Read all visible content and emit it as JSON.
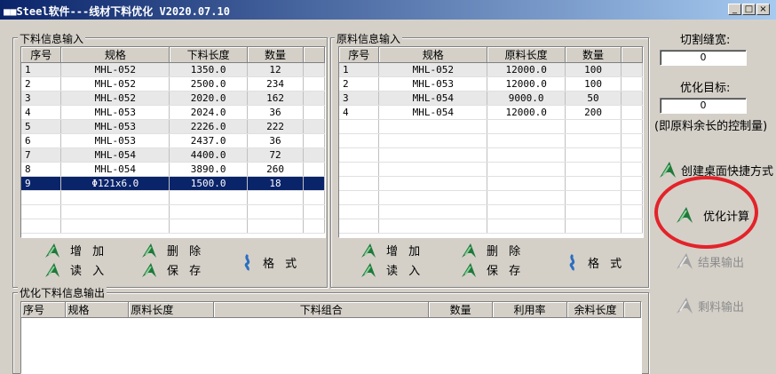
{
  "window": {
    "title": "■■Steel软件---线材下料优化 V2020.07.10",
    "controls": [
      "_",
      "□",
      "×"
    ]
  },
  "cut_group": {
    "title": "下料信息输入",
    "headers": [
      "序号",
      "规格",
      "下料长度",
      "数量"
    ],
    "rows": [
      [
        "1",
        "MHL-052",
        "1350.0",
        "12"
      ],
      [
        "2",
        "MHL-052",
        "2500.0",
        "234"
      ],
      [
        "3",
        "MHL-052",
        "2020.0",
        "162"
      ],
      [
        "4",
        "MHL-053",
        "2024.0",
        "36"
      ],
      [
        "5",
        "MHL-053",
        "2226.0",
        "222"
      ],
      [
        "6",
        "MHL-053",
        "2437.0",
        "36"
      ],
      [
        "7",
        "MHL-054",
        "4400.0",
        "72"
      ],
      [
        "8",
        "MHL-054",
        "3890.0",
        "260"
      ],
      [
        "9",
        "Φ121x6.0",
        "1500.0",
        "18"
      ]
    ],
    "buttons": {
      "add": "增 加",
      "delete": "删 除",
      "read": "读 入",
      "save": "保 存",
      "format": "格 式"
    }
  },
  "raw_group": {
    "title": "原料信息输入",
    "headers": [
      "序号",
      "规格",
      "原料长度",
      "数量"
    ],
    "rows": [
      [
        "1",
        "MHL-052",
        "12000.0",
        "100"
      ],
      [
        "2",
        "MHL-053",
        "12000.0",
        "100"
      ],
      [
        "3",
        "MHL-054",
        "9000.0",
        "50"
      ],
      [
        "4",
        "MHL-054",
        "12000.0",
        "200"
      ]
    ],
    "buttons": {
      "add": "增 加",
      "delete": "删 除",
      "read": "读 入",
      "save": "保 存",
      "format": "格 式"
    }
  },
  "output_group": {
    "title": "优化下料信息输出",
    "headers": [
      "序号",
      "规格",
      "原料长度",
      "下料组合",
      "数量",
      "利用率",
      "余料长度"
    ]
  },
  "side": {
    "kerf_label": "切割缝宽:",
    "kerf_value": "0",
    "target_label": "优化目标:",
    "target_value": "0",
    "target_note": "(即原料余长的控制量)",
    "shortcut_label": "创建桌面快捷方式",
    "optimize_label": "优化计算",
    "result_label": "结果输出",
    "remnant_label": "剩料输出"
  },
  "colors": {
    "title_start": "#0a246a",
    "selection": "#0a246a",
    "highlight_circle": "#e3232a",
    "icon_green": "#1f7a3a"
  }
}
